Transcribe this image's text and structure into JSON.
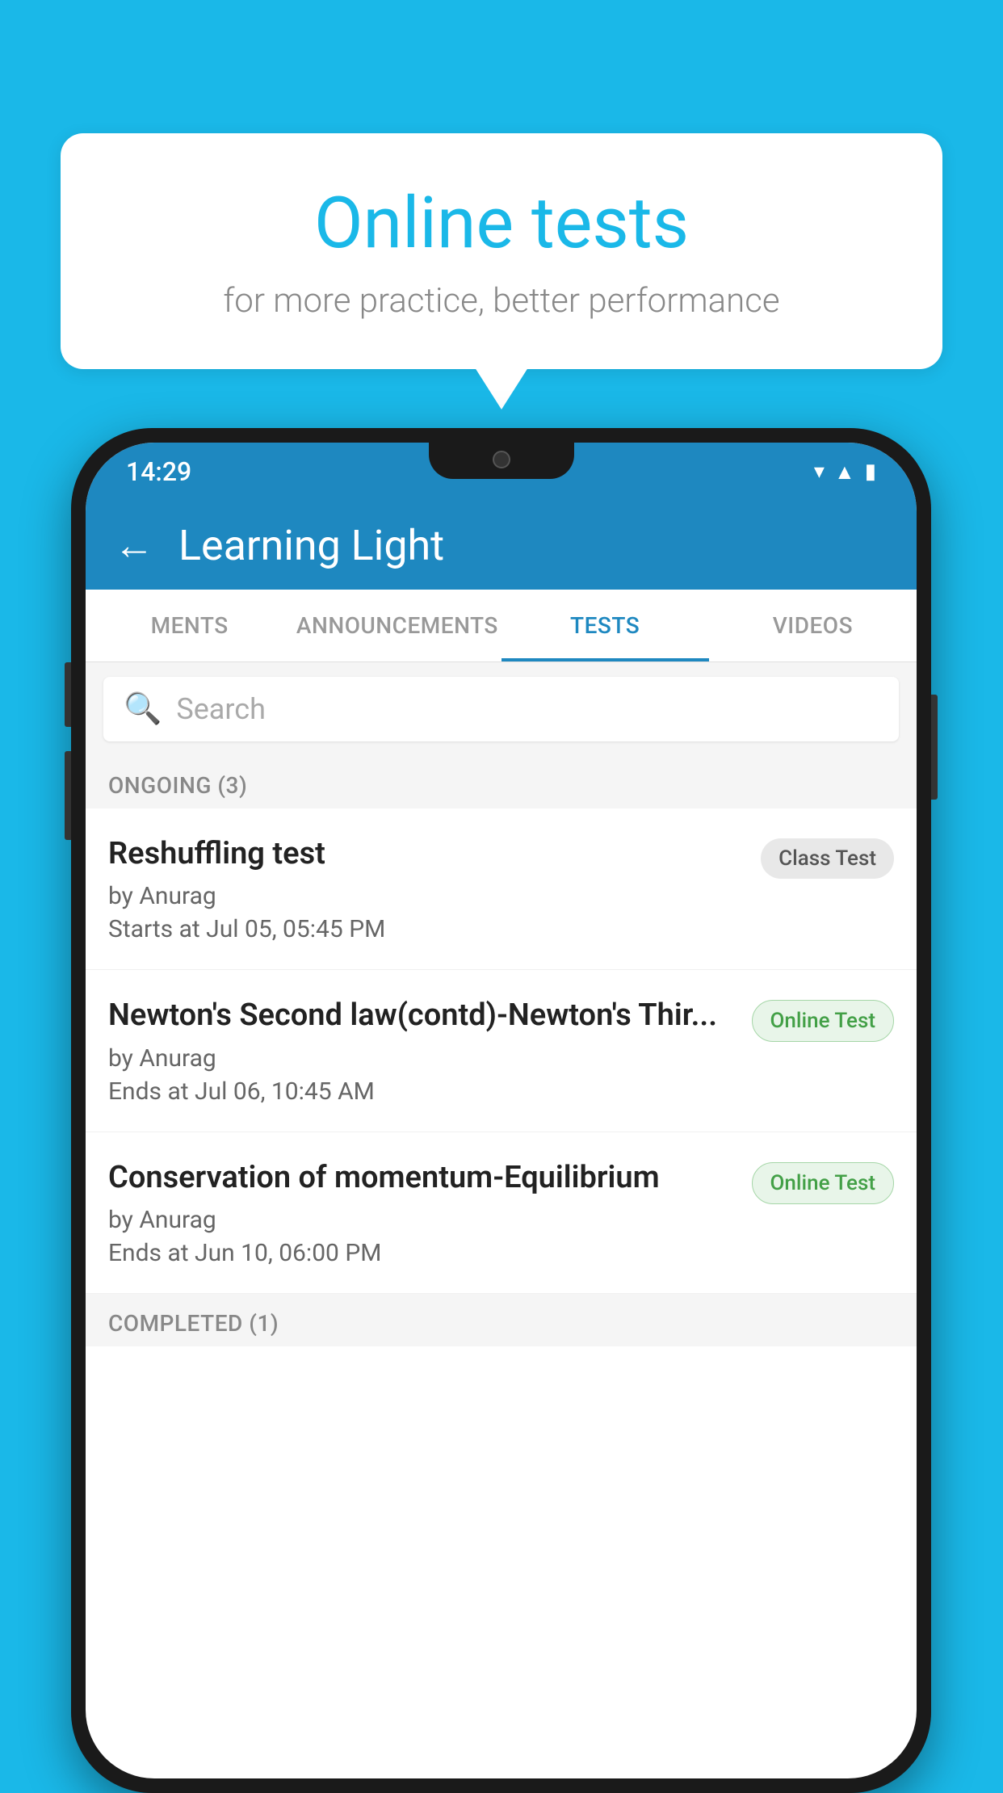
{
  "background": {
    "color": "#1ab8e8"
  },
  "bubble": {
    "title": "Online tests",
    "subtitle": "for more practice, better performance"
  },
  "phone": {
    "status_bar": {
      "time": "14:29",
      "icons": [
        "wifi",
        "signal",
        "battery"
      ]
    },
    "app_bar": {
      "back_label": "←",
      "title": "Learning Light"
    },
    "tabs": [
      {
        "label": "MENTS",
        "active": false
      },
      {
        "label": "ANNOUNCEMENTS",
        "active": false
      },
      {
        "label": "TESTS",
        "active": true
      },
      {
        "label": "VIDEOS",
        "active": false
      }
    ],
    "search": {
      "placeholder": "Search"
    },
    "sections": [
      {
        "header": "ONGOING (3)",
        "items": [
          {
            "name": "Reshuffling test",
            "author": "by Anurag",
            "date": "Starts at  Jul 05, 05:45 PM",
            "badge": "Class Test",
            "badge_type": "class"
          },
          {
            "name": "Newton's Second law(contd)-Newton's Thir...",
            "author": "by Anurag",
            "date": "Ends at  Jul 06, 10:45 AM",
            "badge": "Online Test",
            "badge_type": "online"
          },
          {
            "name": "Conservation of momentum-Equilibrium",
            "author": "by Anurag",
            "date": "Ends at  Jun 10, 06:00 PM",
            "badge": "Online Test",
            "badge_type": "online"
          }
        ]
      }
    ],
    "completed_header": "COMPLETED (1)"
  }
}
